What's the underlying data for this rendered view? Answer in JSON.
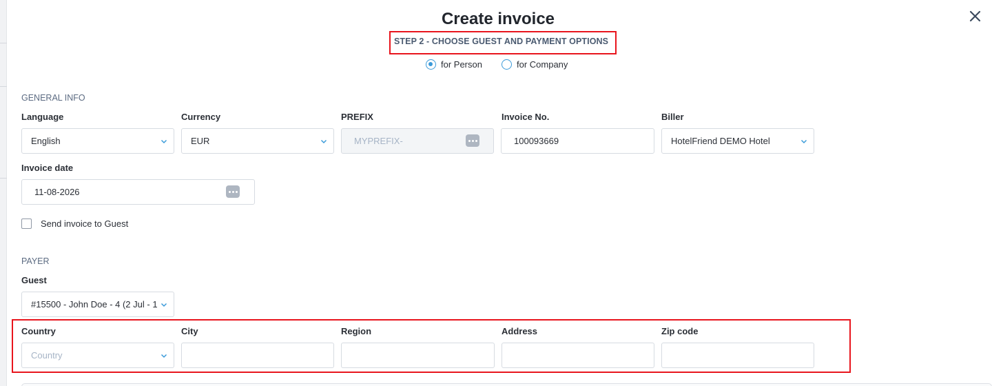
{
  "modal": {
    "title": "Create invoice",
    "step": "STEP 2 - CHOOSE GUEST AND PAYMENT OPTIONS",
    "close_icon": "close-icon",
    "highlight_color": "#e8141c",
    "accent_color": "#3a9ad9"
  },
  "invoice_type": {
    "selected": "for Person",
    "options": [
      "for Person",
      "for Company"
    ]
  },
  "general_info": {
    "heading": "GENERAL INFO",
    "language": {
      "label": "Language",
      "value": "English"
    },
    "currency": {
      "label": "Currency",
      "value": "EUR"
    },
    "prefix": {
      "label": "PREFIX",
      "placeholder": "MYPREFIX-"
    },
    "invoice_no": {
      "label": "Invoice No.",
      "value": "100093669"
    },
    "biller": {
      "label": "Biller",
      "value": "HotelFriend DEMO Hotel"
    },
    "invoice_date": {
      "label": "Invoice date",
      "value": "11-08-2026"
    },
    "send_to_guest": {
      "label": "Send invoice to Guest",
      "checked": false
    }
  },
  "payer": {
    "heading": "PAYER",
    "guest": {
      "label": "Guest",
      "value": "#15500 - John Doe - 4 (2 Jul - 1"
    },
    "country": {
      "label": "Country",
      "placeholder": "Country",
      "value": ""
    },
    "city": {
      "label": "City",
      "value": ""
    },
    "region": {
      "label": "Region",
      "value": ""
    },
    "address": {
      "label": "Address",
      "value": ""
    },
    "zip": {
      "label": "Zip code",
      "value": ""
    }
  }
}
